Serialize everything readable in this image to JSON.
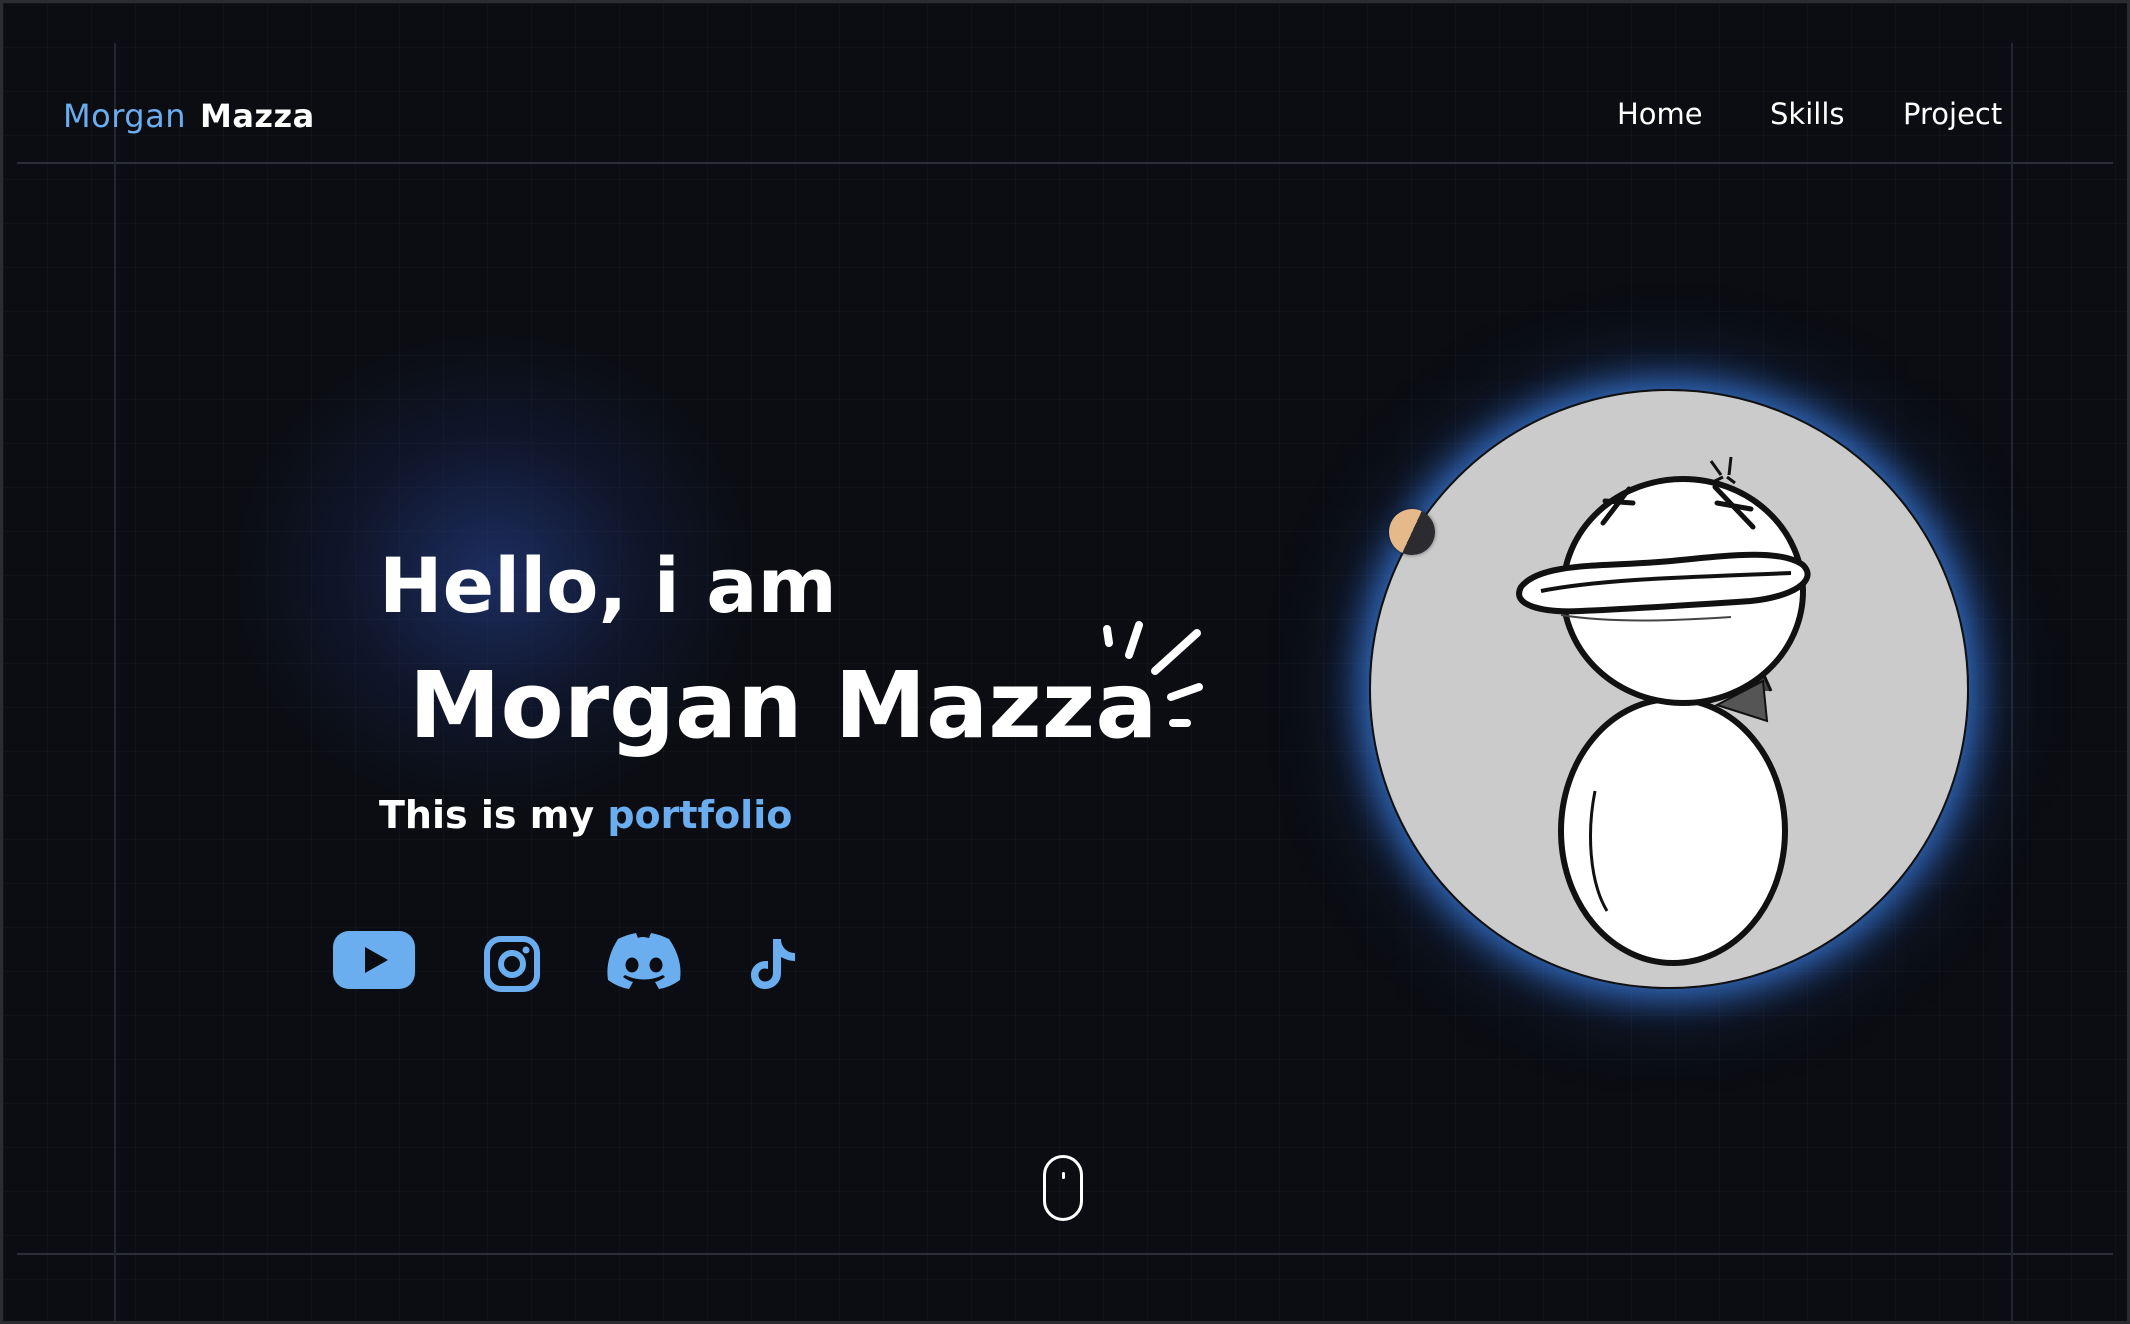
{
  "header": {
    "logo_first": "Morgan",
    "logo_last": "Mazza",
    "nav": [
      {
        "label": "Home"
      },
      {
        "label": "Skills"
      },
      {
        "label": "Project"
      }
    ]
  },
  "hero": {
    "greeting": "Hello, i am",
    "name": "Morgan Mazza",
    "tagline_prefix": "This is my ",
    "tagline_accent": "portfolio"
  },
  "socials": [
    {
      "icon": "youtube-icon"
    },
    {
      "icon": "instagram-icon"
    },
    {
      "icon": "discord-icon"
    },
    {
      "icon": "tiktok-icon"
    }
  ],
  "colors": {
    "accent": "#6aaef0",
    "background": "#0b0d12",
    "text": "#ffffff",
    "avatar_bg": "#cbcbcb",
    "glow": "#3c82e6"
  }
}
